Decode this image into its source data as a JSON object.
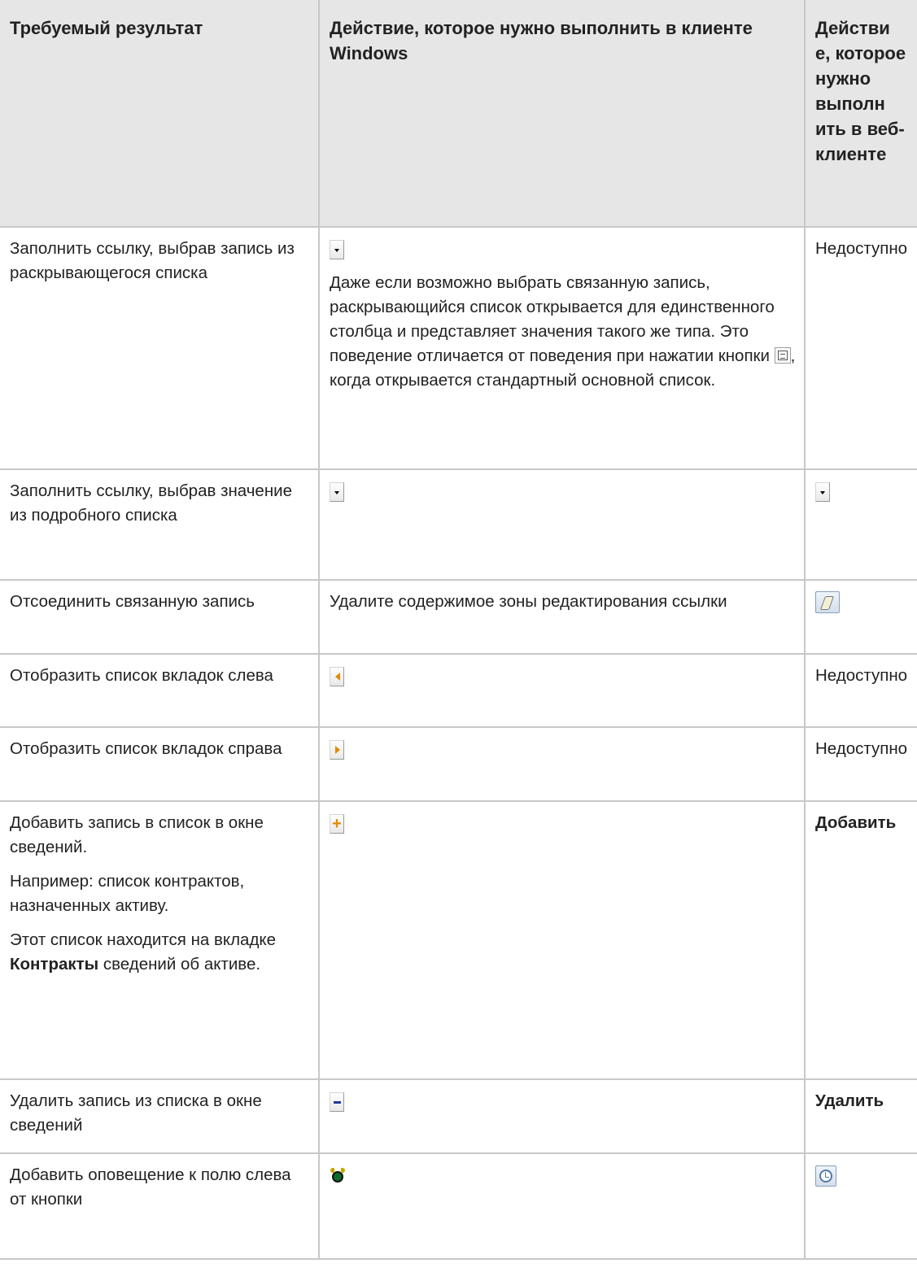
{
  "table": {
    "headers": [
      "Требуемый результат",
      "Действие, которое нужно выполнить в клиенте Windows",
      "Действи е, которое нужно выполн ить в веб-клиенте"
    ],
    "rows": [
      {
        "result": "Заполнить ссылку, выбрав запись из раскрывающегося списка",
        "windows_icon": "dropdown-arrow-icon",
        "windows_text_before": "Даже если возможно выбрать связанную запись, раскрывающийся список открывается для единственного столбца и представляет значения такого же типа. Это поведение отличается от поведения при нажатии кнопки",
        "windows_inline_icon": "list-icon",
        "windows_text_after": ", когда открывается стандартный основной список.",
        "web": "Недоступно"
      },
      {
        "result": "Заполнить ссылку, выбрав значение из подробного списка",
        "windows_icon": "dropdown-arrow-icon",
        "web_icon": "dropdown-arrow-icon"
      },
      {
        "result": "Отсоединить связанную запись",
        "windows": "Удалите содержимое зоны редактирования ссылки",
        "web_icon": "eraser-icon"
      },
      {
        "result": "Отобразить список вкладок слева",
        "windows_icon": "arrow-left-icon",
        "web": "Недоступно"
      },
      {
        "result": "Отобразить список вкладок справа",
        "windows_icon": "arrow-right-icon",
        "web": "Недоступно"
      },
      {
        "result_lines": [
          "Добавить запись в список в окне сведений.",
          "Например: список контрактов, назначенных активу."
        ],
        "result_note_before": "Этот список находится на вкладке",
        "result_note_bold": "Контракты",
        "result_note_after": "сведений об активе.",
        "windows_icon": "plus-icon",
        "windows_icon_text": "+",
        "web": "Добавить"
      },
      {
        "result": "Удалить запись из списка в окне сведений",
        "windows_icon": "minus-icon",
        "web": "Удалить"
      },
      {
        "result": "Добавить оповещение к полю слева от кнопки",
        "windows_icon": "alarm-clock-icon",
        "web_icon": "clock-icon"
      }
    ]
  }
}
